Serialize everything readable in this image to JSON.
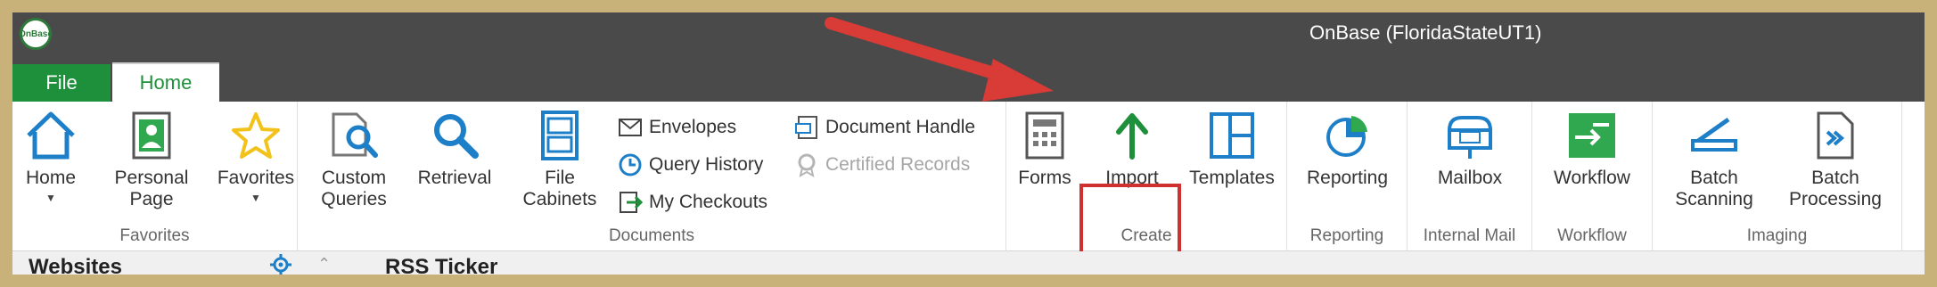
{
  "window": {
    "title": "OnBase (FloridaStateUT1)",
    "logo_text": "OnBase"
  },
  "tabs": [
    {
      "label": "File",
      "active": false,
      "color": "#1e8f3a"
    },
    {
      "label": "Home",
      "active": true
    }
  ],
  "ribbon": {
    "favorites": {
      "label": "Favorites",
      "buttons": [
        {
          "label": "Home",
          "icon": "house-icon",
          "has_dropdown": true
        },
        {
          "label": "Personal Page",
          "icon": "personal-page-icon",
          "has_dropdown": true
        },
        {
          "label": "Favorites",
          "icon": "star-icon",
          "has_dropdown": true
        }
      ]
    },
    "documents": {
      "label": "Documents",
      "buttons": [
        {
          "label": "Custom Queries",
          "icon": "custom-queries-icon"
        },
        {
          "label": "Retrieval",
          "icon": "magnifier-icon"
        },
        {
          "label": "File Cabinets",
          "icon": "file-cabinet-icon"
        }
      ],
      "small_buttons": [
        {
          "label": "Envelopes",
          "icon": "envelope-icon",
          "enabled": true
        },
        {
          "label": "Query History",
          "icon": "clock-icon",
          "enabled": true
        },
        {
          "label": "My Checkouts",
          "icon": "checkout-icon",
          "enabled": true
        },
        {
          "label": "Document Handle",
          "icon": "document-handle-icon",
          "enabled": true
        },
        {
          "label": "Certified Records",
          "icon": "certified-records-icon",
          "enabled": false
        }
      ]
    },
    "create": {
      "label": "Create",
      "buttons": [
        {
          "label": "Forms",
          "icon": "forms-icon"
        },
        {
          "label": "Import",
          "icon": "import-arrow-icon",
          "highlighted": true
        },
        {
          "label": "Templates",
          "icon": "templates-icon"
        }
      ]
    },
    "reporting": {
      "label": "Reporting",
      "buttons": [
        {
          "label": "Reporting",
          "icon": "reporting-icon"
        }
      ]
    },
    "internal_mail": {
      "label": "Internal Mail",
      "buttons": [
        {
          "label": "Mailbox",
          "icon": "mailbox-icon"
        }
      ]
    },
    "workflow": {
      "label": "Workflow",
      "buttons": [
        {
          "label": "Workflow",
          "icon": "workflow-icon"
        }
      ]
    },
    "imaging": {
      "label": "Imaging",
      "buttons": [
        {
          "label": "Batch Scanning",
          "icon": "scanner-icon"
        },
        {
          "label": "Batch Processing",
          "icon": "batch-processing-icon"
        }
      ]
    }
  },
  "lower_panel": {
    "websites_title": "Websites",
    "rss_title": "RSS Ticker"
  },
  "colors": {
    "accent_green": "#1e8f3a",
    "icon_blue": "#1e7fc9",
    "highlight_red": "#d13030",
    "border_gold": "#c8b27a"
  }
}
